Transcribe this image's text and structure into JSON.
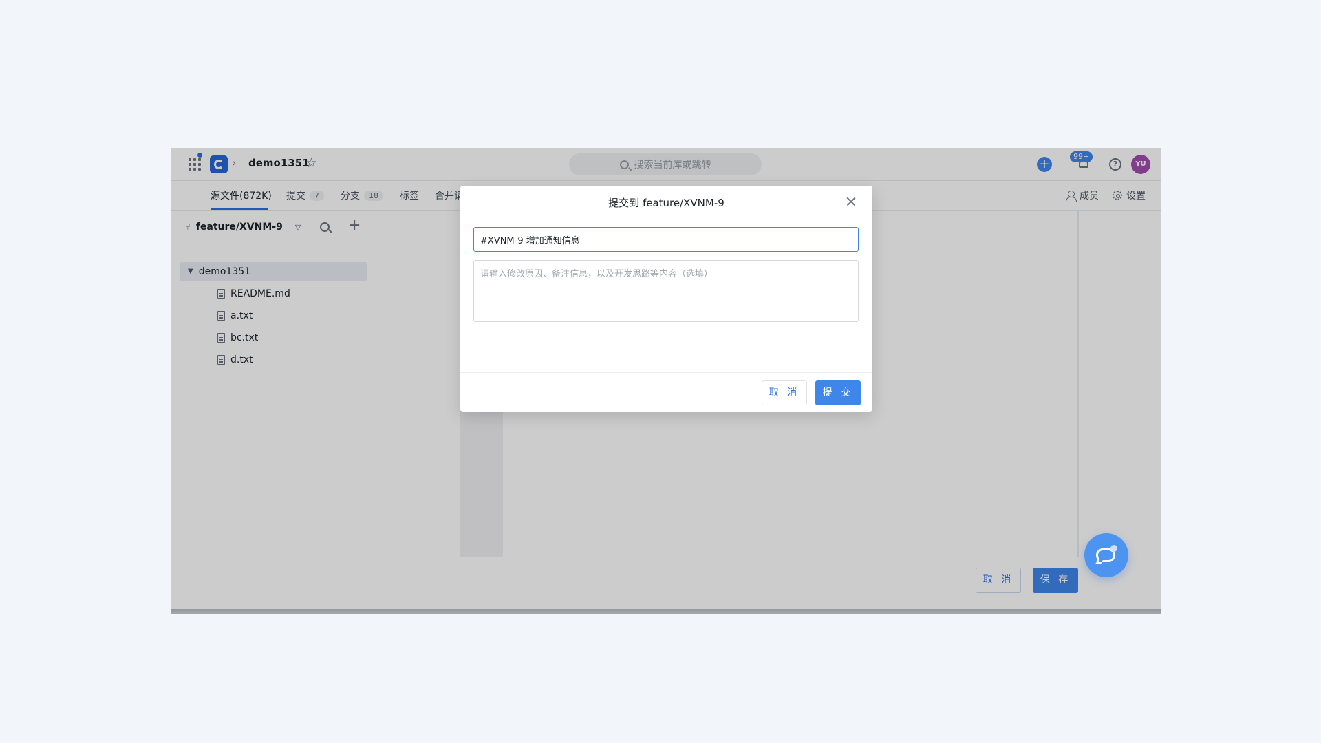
{
  "topbar": {
    "repo_name": "demo1351",
    "search_placeholder": "搜索当前库或跳转",
    "notification_badge": "99+",
    "avatar_initials": "YU",
    "breadcrumb_separator": "›"
  },
  "tabs": [
    {
      "label": "源文件(872K)",
      "count": ""
    },
    {
      "label": "提交",
      "count": "7"
    },
    {
      "label": "分支",
      "count": "18"
    },
    {
      "label": "标签",
      "count": ""
    },
    {
      "label": "合并请",
      "count": ""
    }
  ],
  "tabs_right": {
    "members": "成员",
    "settings": "设置"
  },
  "sidebar": {
    "branch": "feature/XVNM-9",
    "tree_root": "demo1351",
    "files": [
      "README.md",
      "a.txt",
      "bc.txt",
      "d.txt"
    ]
  },
  "editor": {
    "cancel_label": "取 消",
    "save_label": "保 存"
  },
  "modal": {
    "title": "提交到 feature/XVNM-9",
    "commit_title_value": "#XVNM-9 增加通知信息",
    "description_placeholder": "请输入修改原因、备注信息，以及开发思路等内容（选填）",
    "cancel_label": "取 消",
    "submit_label": "提 交"
  },
  "colors": {
    "accent": "#3f86ea",
    "brand_logo": "#2568d8",
    "avatar": "#a24caf"
  }
}
